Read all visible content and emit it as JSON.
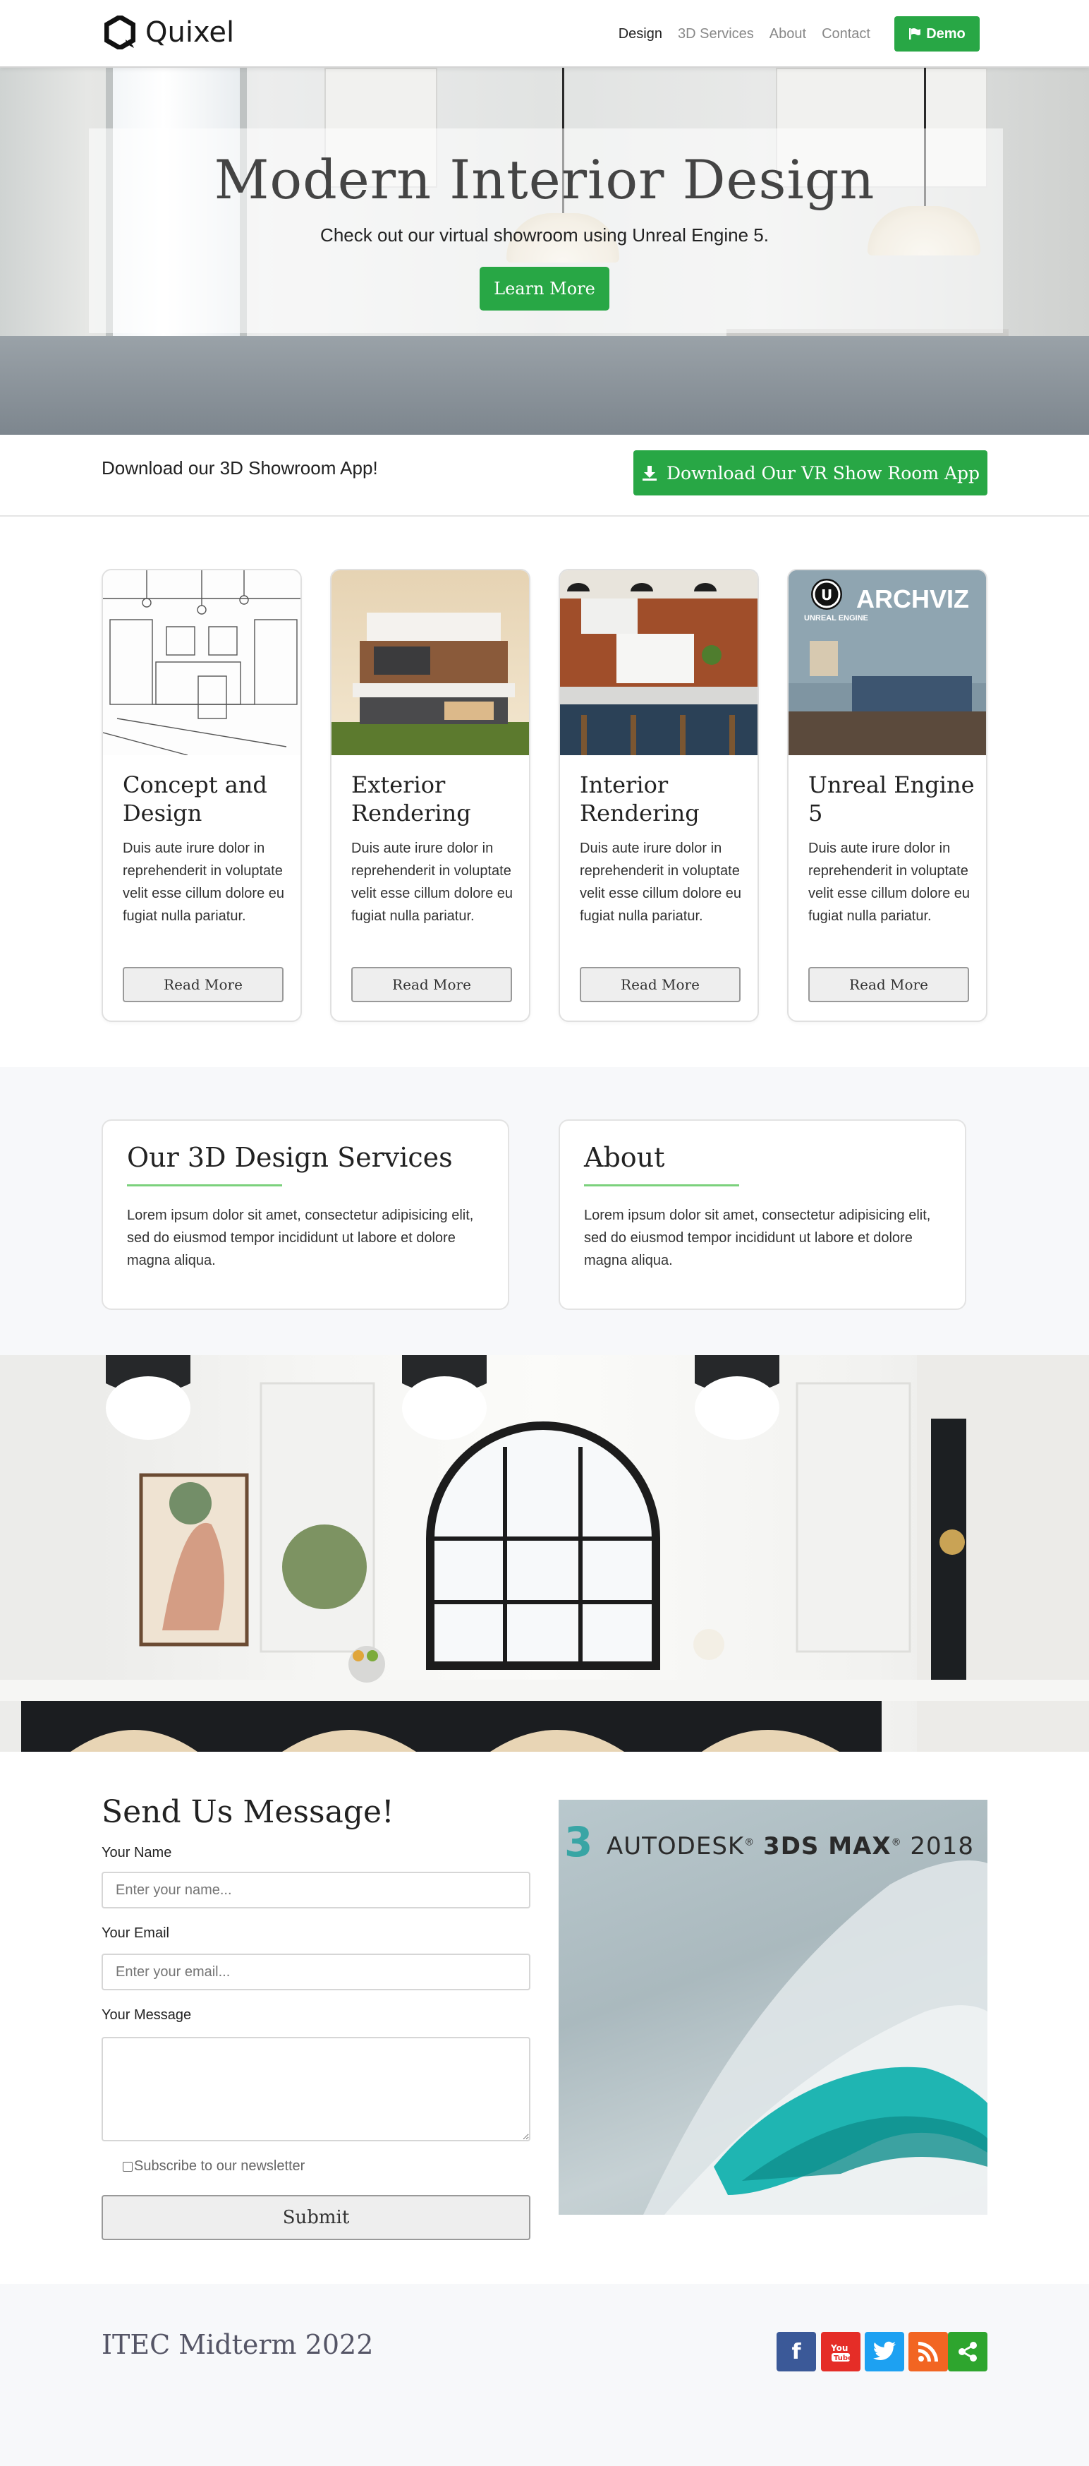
{
  "header": {
    "brand": "Quixel",
    "nav": [
      "Design",
      "3D Services",
      "About",
      "Contact"
    ],
    "demo_label": "Demo"
  },
  "hero": {
    "title": "Modern Interior Design",
    "subtitle": "Check out our virtual showroom using Unreal Engine 5.",
    "button": "Learn More"
  },
  "download": {
    "text": "Download our 3D Showroom App!",
    "button": "Download Our VR Show Room App"
  },
  "cards": [
    {
      "title": "Concept and Design",
      "body": "Duis aute irure dolor in reprehenderit in voluptate velit esse cillum dolore eu fugiat nulla pariatur.",
      "button": "Read More"
    },
    {
      "title": "Exterior Rendering",
      "body": "Duis aute irure dolor in reprehenderit in voluptate velit esse cillum dolore eu fugiat nulla pariatur.",
      "button": "Read More"
    },
    {
      "title": "Interior Rendering",
      "body": "Duis aute irure dolor in reprehenderit in voluptate velit esse cillum dolore eu fugiat nulla pariatur.",
      "button": "Read More"
    },
    {
      "title": "Unreal Engine 5",
      "body": "Duis aute irure dolor in reprehenderit in voluptate velit esse cillum dolore eu fugiat nulla pariatur.",
      "button": "Read More",
      "image_text": {
        "logo": "UNREAL ENGINE",
        "tag": "ARCHVIZ"
      }
    }
  ],
  "services": {
    "title": "Our 3D Design Services",
    "body": "Lorem ipsum dolor sit amet, consectetur adipisicing elit, sed do eiusmod tempor incididunt ut labore et dolore magna aliqua."
  },
  "about": {
    "title": "About",
    "body": "Lorem ipsum dolor sit amet, consectetur adipisicing elit, sed do eiusmod tempor incididunt ut labore et dolore magna aliqua."
  },
  "form": {
    "title": "Send Us Message!",
    "name_label": "Your Name",
    "name_placeholder": "Enter your name...",
    "email_label": "Your Email",
    "email_placeholder": "Enter your email...",
    "message_label": "Your Message",
    "newsletter": "Subscribe to our newsletter",
    "submit": "Submit"
  },
  "ad": {
    "brand": "AUTODESK",
    "product": "3DS MAX",
    "year": "2018"
  },
  "footer": {
    "title": "ITEC Midterm 2022",
    "social": [
      {
        "icon": "facebook-icon",
        "color": "#3b5998"
      },
      {
        "icon": "youtube-icon",
        "color": "#e52d27"
      },
      {
        "icon": "twitter-icon",
        "color": "#1da1f2"
      },
      {
        "icon": "rss-icon",
        "color": "#f26522"
      },
      {
        "icon": "share-icon",
        "color": "#2ea52e"
      }
    ]
  },
  "colors": {
    "accent": "#28a745",
    "underline": "#7bd17c"
  }
}
